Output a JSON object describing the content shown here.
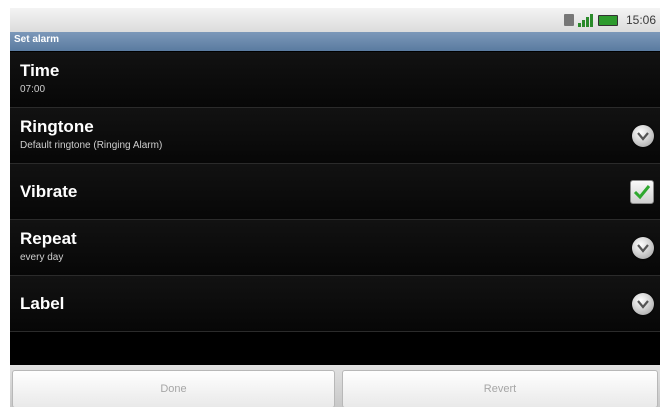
{
  "status_bar": {
    "time": "15:06"
  },
  "title_bar": {
    "title": "Set alarm"
  },
  "rows": [
    {
      "title": "Time",
      "subtitle": "07:00"
    },
    {
      "title": "Ringtone",
      "subtitle": "Default ringtone (Ringing Alarm)"
    },
    {
      "title": "Vibrate",
      "checked": true
    },
    {
      "title": "Repeat",
      "subtitle": "every day"
    },
    {
      "title": "Label"
    }
  ],
  "buttons": {
    "done": "Done",
    "revert": "Revert"
  }
}
